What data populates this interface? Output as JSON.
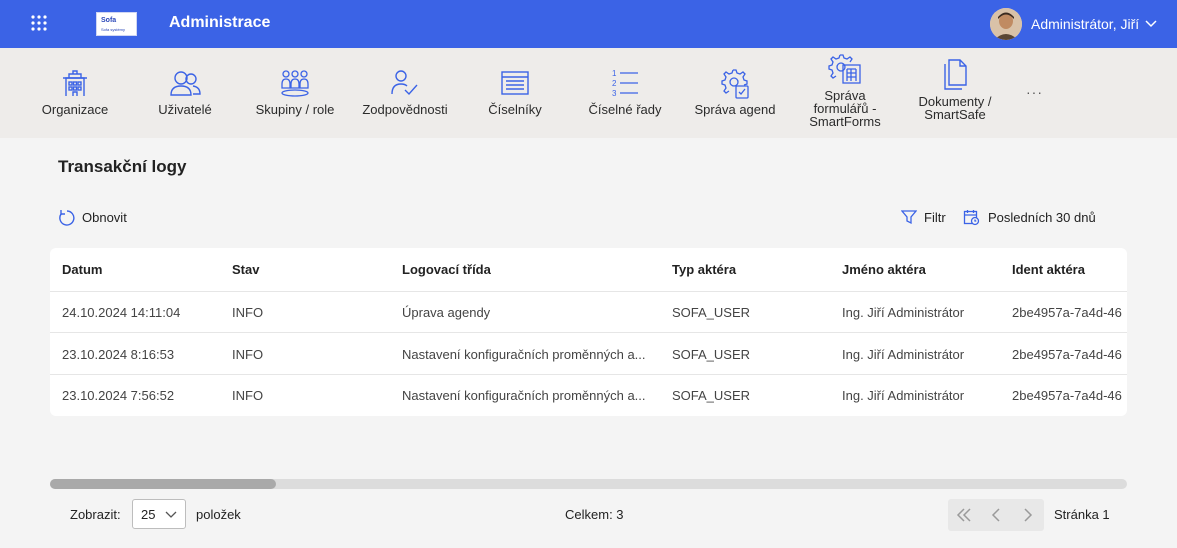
{
  "header": {
    "logo_text": "Sofa",
    "logo_subtext": "Sofa systémy",
    "title": "Administrace",
    "user_name": "Administrátor, Jiří"
  },
  "ribbon": {
    "items": [
      {
        "label": "Organizace",
        "icon": "building-icon"
      },
      {
        "label": "Uživatelé",
        "icon": "users-icon"
      },
      {
        "label": "Skupiny / role",
        "icon": "group-icon"
      },
      {
        "label": "Zodpovědnosti",
        "icon": "user-check-icon"
      },
      {
        "label": "Číselníky",
        "icon": "list-window-icon"
      },
      {
        "label": "Číselné řady",
        "icon": "numbered-list-icon"
      },
      {
        "label": "Správa agend",
        "icon": "gear-clipboard-icon"
      },
      {
        "label_lines": [
          "Správa",
          "formulářů -",
          "SmartForms"
        ],
        "icon": "gear-form-icon"
      },
      {
        "label_lines": [
          "Dokumenty /",
          "SmartSafe"
        ],
        "icon": "documents-icon"
      }
    ],
    "more": "···"
  },
  "main": {
    "title": "Transakční logy",
    "refresh_label": "Obnovit",
    "filter_label": "Filtr",
    "period_label": "Posledních 30 dnů"
  },
  "table": {
    "columns": [
      "Datum",
      "Stav",
      "Logovací třída",
      "Typ aktéra",
      "Jméno aktéra",
      "Ident aktéra"
    ],
    "rows": [
      [
        "24.10.2024 14:11:04",
        "INFO",
        "Úprava agendy",
        "SOFA_USER",
        "Ing. Jiří Administrátor",
        "2be4957a-7a4d-46"
      ],
      [
        "23.10.2024 8:16:53",
        "INFO",
        "Nastavení konfiguračních proměnných a...",
        "SOFA_USER",
        "Ing. Jiří Administrátor",
        "2be4957a-7a4d-46"
      ],
      [
        "23.10.2024 7:56:52",
        "INFO",
        "Nastavení konfiguračních proměnných a...",
        "SOFA_USER",
        "Ing. Jiří Administrátor",
        "2be4957a-7a4d-46"
      ]
    ]
  },
  "footer": {
    "show_label": "Zobrazit:",
    "page_size": "25",
    "items_label": "položek",
    "total": "Celkem: 3",
    "page_label": "Stránka 1"
  },
  "colors": {
    "primary": "#3b63e6",
    "ribbon_bg": "#eeecea",
    "icon_blue": "#3b63e6"
  }
}
